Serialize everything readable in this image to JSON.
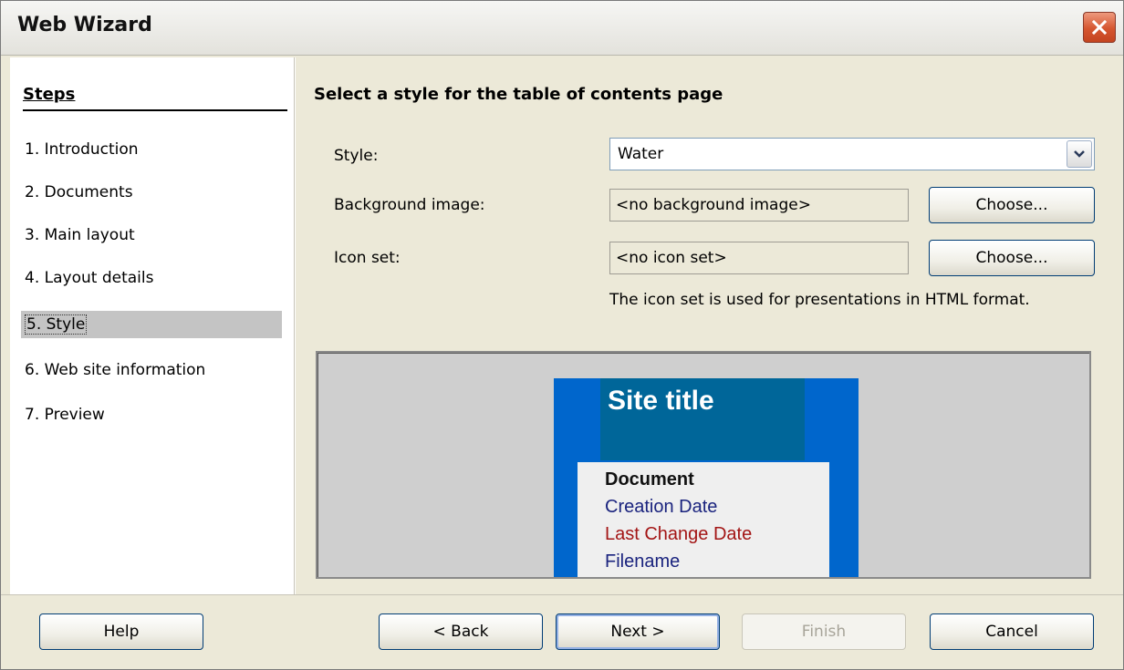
{
  "window": {
    "title": "Web Wizard"
  },
  "sidebar": {
    "title": "Steps",
    "items": [
      {
        "label": "1.  Introduction"
      },
      {
        "label": "2.  Documents"
      },
      {
        "label": "3.  Main layout"
      },
      {
        "label": "4.  Layout details"
      },
      {
        "label": "5.  Style",
        "active": true
      },
      {
        "label": "6.  Web site information"
      },
      {
        "label": "7.  Preview"
      }
    ]
  },
  "main": {
    "heading": "Select a style for the table of contents page",
    "style_label": "Style:",
    "style_value": "Water",
    "background_label": "Background image:",
    "background_value": "<no background image>",
    "icon_set_label": "Icon set:",
    "icon_set_value": "<no icon set>",
    "choose_label": "Choose...",
    "note": "The icon set is used for presentations in HTML format."
  },
  "preview": {
    "site_title": "Site title",
    "document": "Document",
    "creation_date": "Creation Date",
    "last_change_date": "Last Change Date",
    "filename": "Filename",
    "colors": {
      "outer": "#0066cc",
      "title_box": "#006699",
      "creation_date": "#1a237e",
      "last_change_date": "#a31515",
      "filename": "#1a237e"
    }
  },
  "footer": {
    "help": "Help",
    "back": "< Back",
    "next": "Next >",
    "finish": "Finish",
    "cancel": "Cancel"
  }
}
